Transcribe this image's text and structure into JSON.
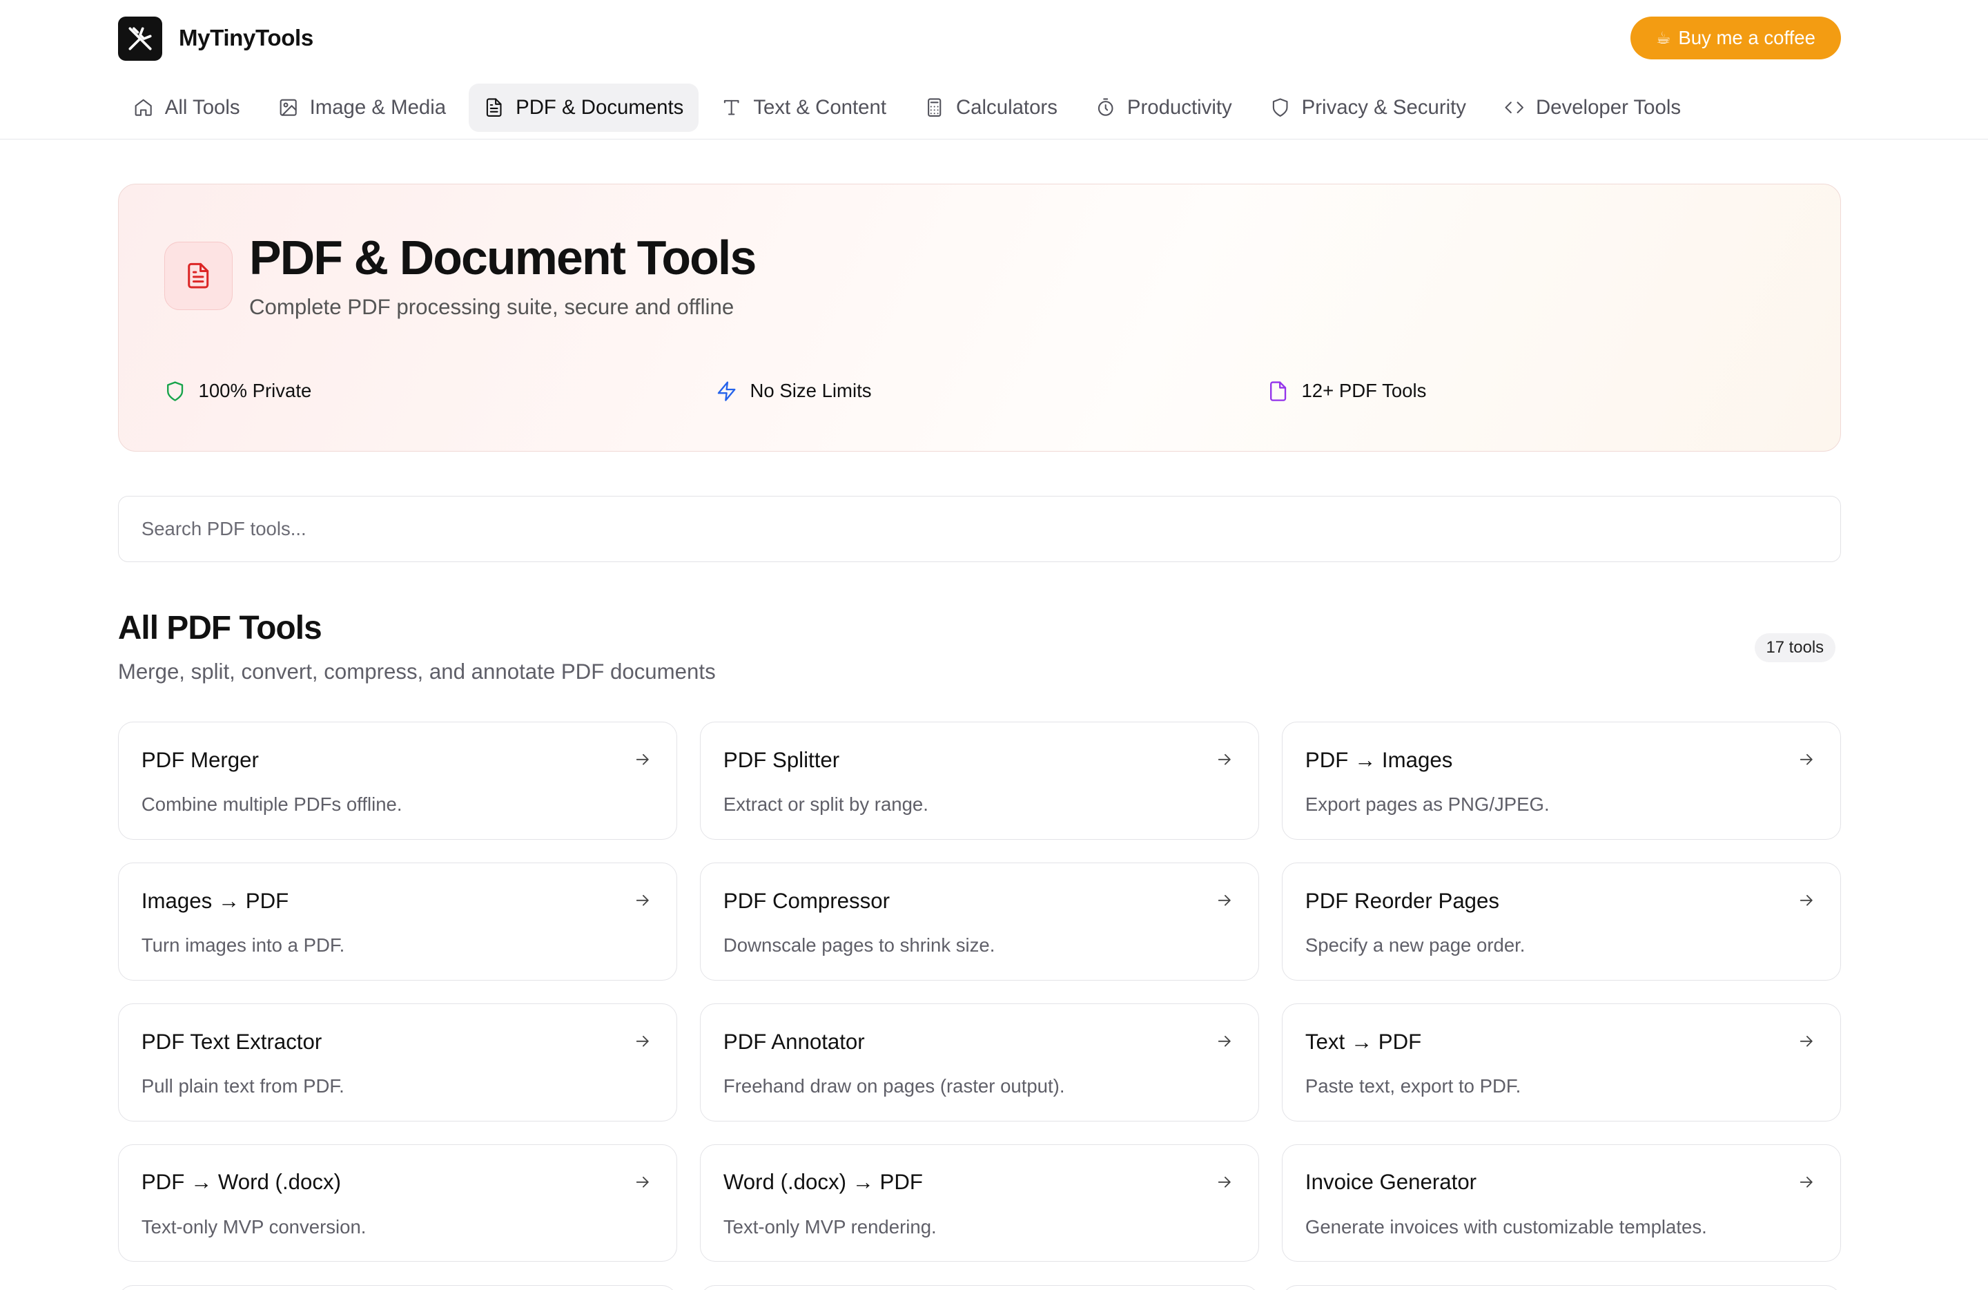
{
  "header": {
    "brand": "MyTinyTools",
    "coffee_icon": "coffee-cup-icon",
    "coffee_label": "Buy me a coffee"
  },
  "nav": {
    "items": [
      {
        "label": "All Tools",
        "icon": "home-icon",
        "active": false
      },
      {
        "label": "Image & Media",
        "icon": "image-icon",
        "active": false
      },
      {
        "label": "PDF & Documents",
        "icon": "document-icon",
        "active": true
      },
      {
        "label": "Text & Content",
        "icon": "text-icon",
        "active": false
      },
      {
        "label": "Calculators",
        "icon": "calculator-icon",
        "active": false
      },
      {
        "label": "Productivity",
        "icon": "timer-icon",
        "active": false
      },
      {
        "label": "Privacy & Security",
        "icon": "shield-icon",
        "active": false
      },
      {
        "label": "Developer Tools",
        "icon": "code-icon",
        "active": false
      }
    ]
  },
  "hero": {
    "icon": "file-text-icon",
    "title": "PDF & Document Tools",
    "subtitle": "Complete PDF processing suite, secure and offline",
    "features": [
      {
        "label": "100% Private",
        "icon": "shield-check-icon",
        "color": "#16a34a"
      },
      {
        "label": "No Size Limits",
        "icon": "lightning-icon",
        "color": "#2563eb"
      },
      {
        "label": "12+ PDF Tools",
        "icon": "file-icon",
        "color": "#9333ea"
      }
    ]
  },
  "search": {
    "placeholder": "Search PDF tools...",
    "value": ""
  },
  "section": {
    "title": "All PDF Tools",
    "subtitle": "Merge, split, convert, compress, and annotate PDF documents",
    "count": "17 tools"
  },
  "tools": [
    {
      "title": "PDF Merger",
      "desc": "Combine multiple PDFs offline."
    },
    {
      "title": "PDF Splitter",
      "desc": "Extract or split by range."
    },
    {
      "title": "PDF → Images",
      "desc": "Export pages as PNG/JPEG."
    },
    {
      "title": "Images → PDF",
      "desc": "Turn images into a PDF."
    },
    {
      "title": "PDF Compressor",
      "desc": "Downscale pages to shrink size."
    },
    {
      "title": "PDF Reorder Pages",
      "desc": "Specify a new page order."
    },
    {
      "title": "PDF Text Extractor",
      "desc": "Pull plain text from PDF."
    },
    {
      "title": "PDF Annotator",
      "desc": "Freehand draw on pages (raster output)."
    },
    {
      "title": "Text → PDF",
      "desc": "Paste text, export to PDF."
    },
    {
      "title": "PDF → Word (.docx)",
      "desc": "Text-only MVP conversion."
    },
    {
      "title": "Word (.docx) → PDF",
      "desc": "Text-only MVP rendering."
    },
    {
      "title": "Invoice Generator",
      "desc": "Generate invoices with customizable templates."
    }
  ],
  "colors": {
    "accent": "#f39c12",
    "hero_icon": "#dc2626"
  }
}
